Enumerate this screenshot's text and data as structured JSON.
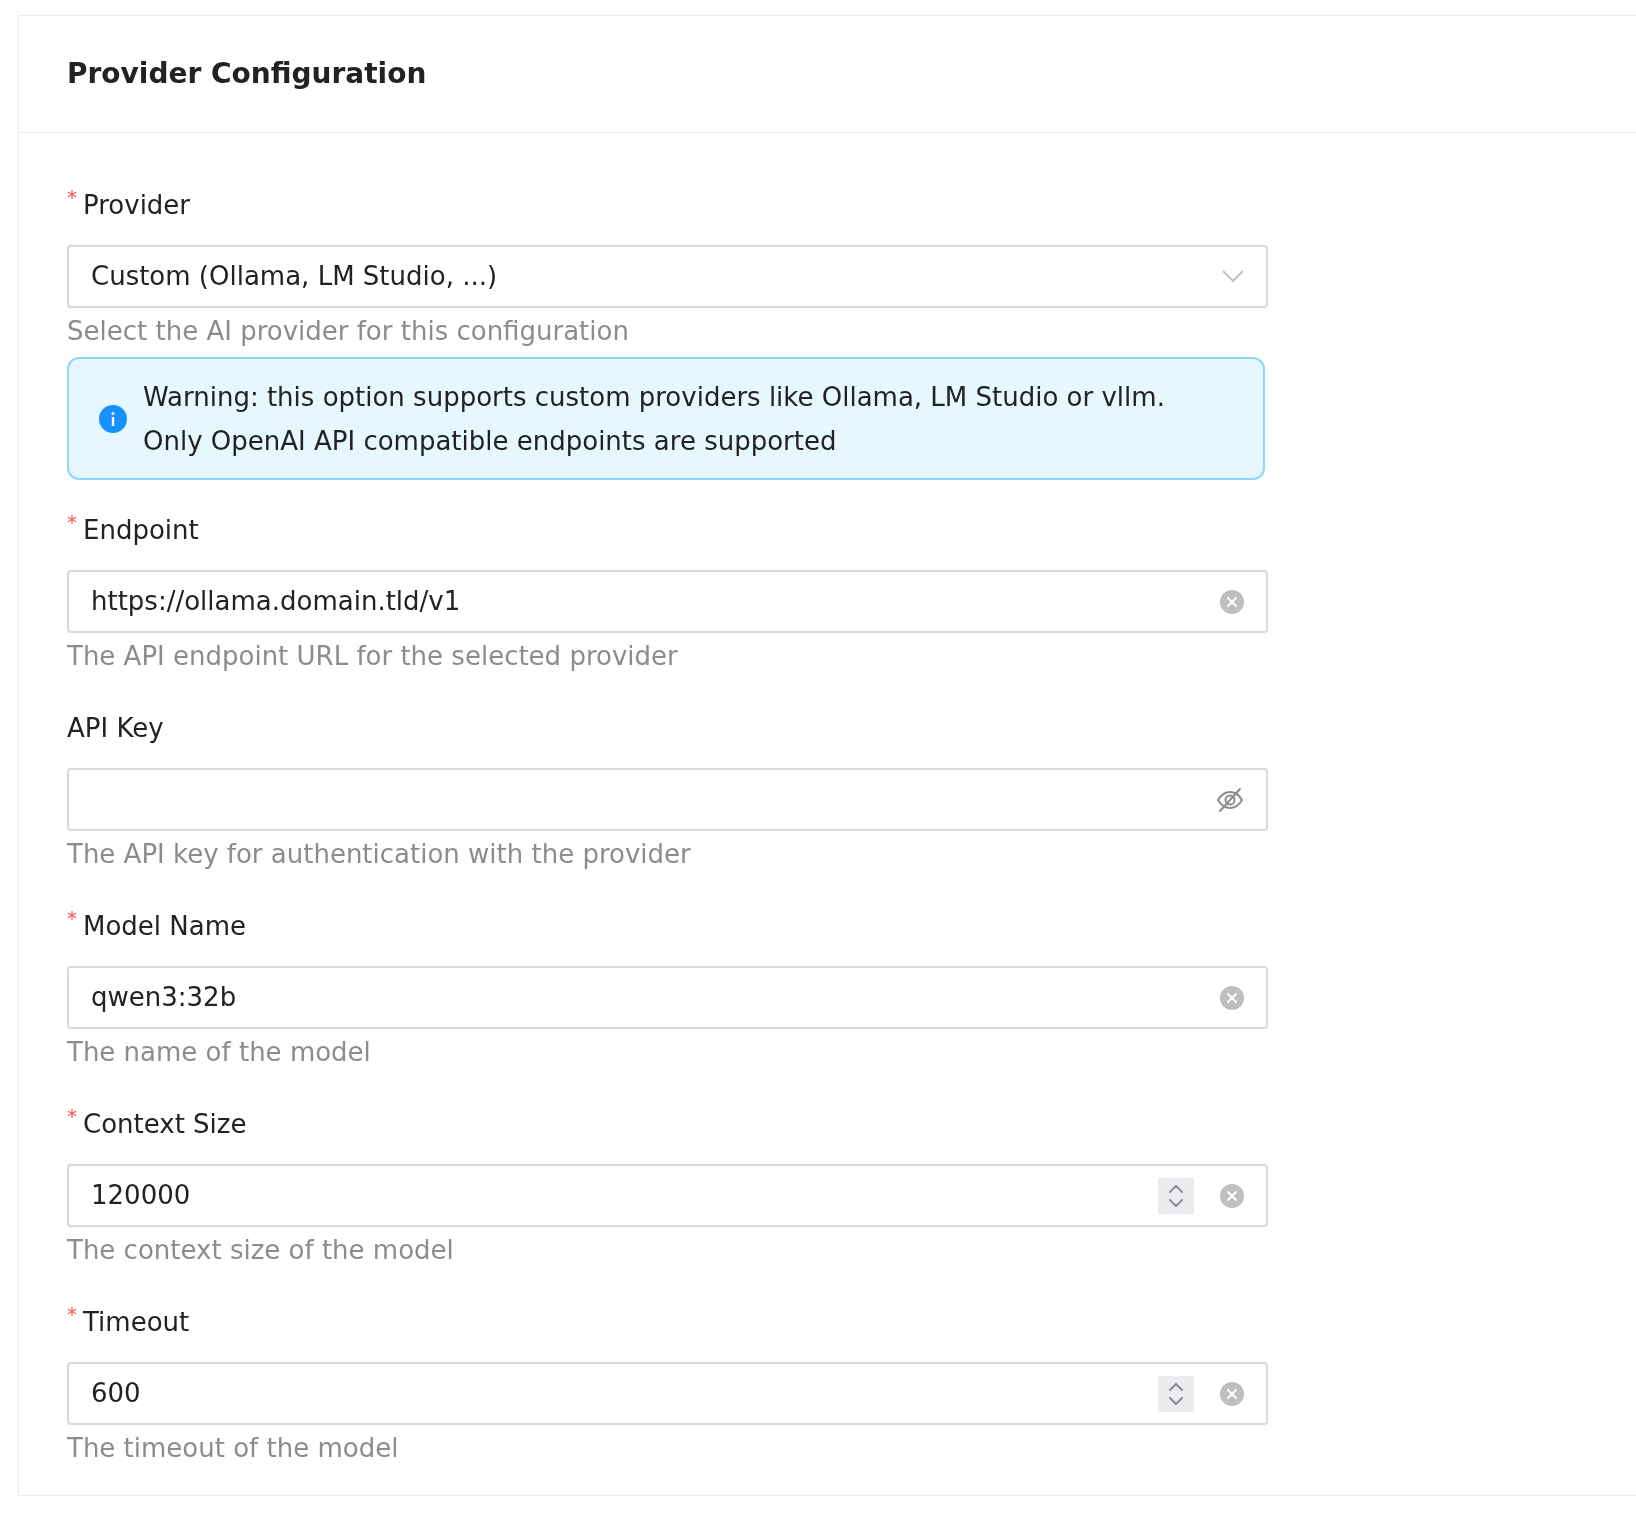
{
  "card": {
    "title": "Provider Configuration"
  },
  "fields": [
    {
      "kind": "select",
      "label": "Provider",
      "required_mark": "*",
      "value": "Custom (Ollama, LM Studio, ...)",
      "help": "Select the AI provider for this configuration",
      "alert": {
        "lines": [
          "Warning: this option supports custom providers like Ollama, LM Studio or vllm.",
          "Only OpenAI API compatible endpoints are supported"
        ]
      }
    },
    {
      "kind": "text",
      "label": "Endpoint",
      "required_mark": "*",
      "value": "https://ollama.domain.tld/v1",
      "help": "The API endpoint URL for the selected provider"
    },
    {
      "kind": "password",
      "label": "API Key",
      "help": "The API key for authentication with the provider"
    },
    {
      "kind": "text",
      "label": "Model Name",
      "required_mark": "*",
      "value": "qwen3:32b",
      "help": "The name of the model"
    },
    {
      "kind": "number",
      "label": "Context Size",
      "required_mark": "*",
      "value": "120000",
      "help": "The context size of the model"
    },
    {
      "kind": "number",
      "label": "Timeout",
      "required_mark": "*",
      "value": "600",
      "help": "The timeout of the model"
    }
  ]
}
